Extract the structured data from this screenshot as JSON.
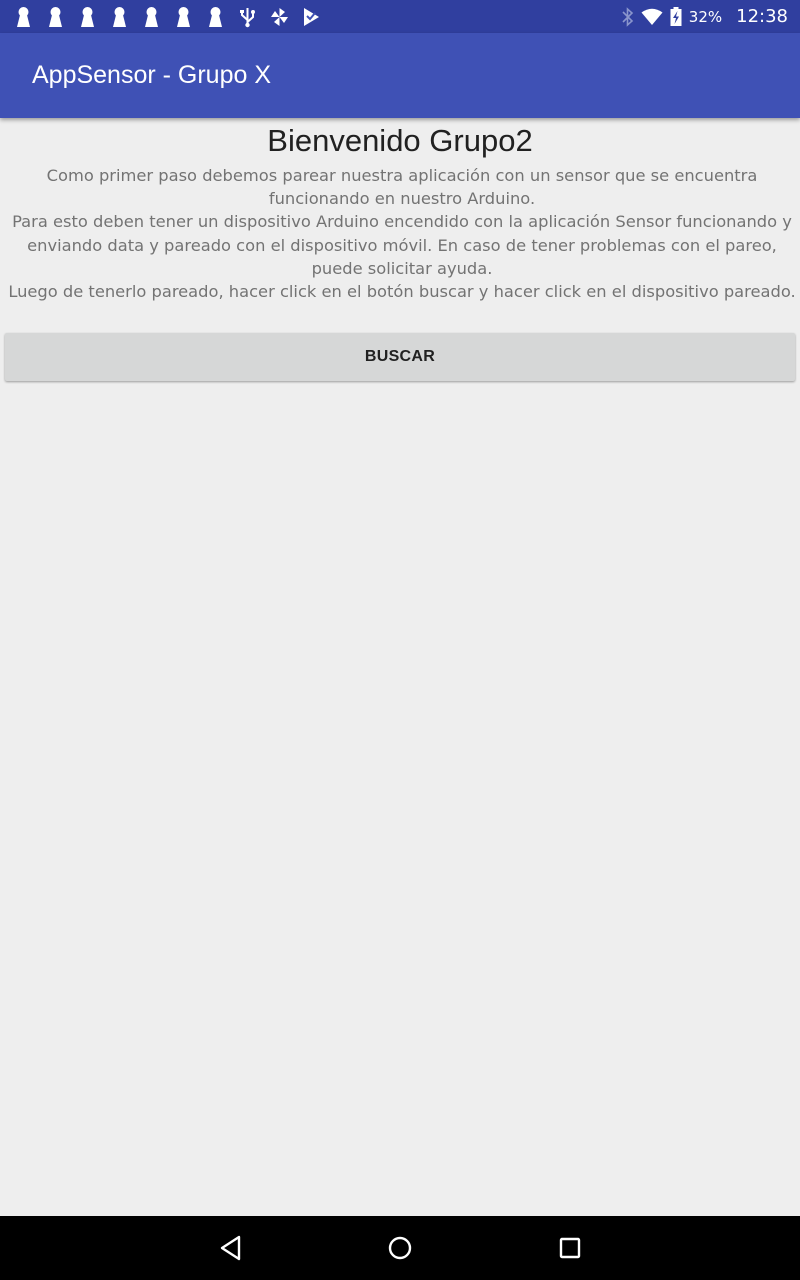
{
  "status_bar": {
    "notification_icons": [
      "keyhole-icon",
      "keyhole-icon",
      "keyhole-icon",
      "keyhole-icon",
      "keyhole-icon",
      "keyhole-icon",
      "keyhole-icon",
      "usb-icon",
      "pinwheel-icon",
      "check-flag-icon"
    ],
    "bluetooth_icon": "bluetooth-icon",
    "wifi_icon": "wifi-icon",
    "battery_icon": "battery-charging-icon",
    "battery_percent": "32%",
    "time": "12:38"
  },
  "app_bar": {
    "title": "AppSensor - Grupo X",
    "color": "#3f51b5",
    "status_color": "#303f9f"
  },
  "main": {
    "welcome": "Bienvenido Grupo2",
    "instructions": [
      "Como primer paso debemos parear nuestra aplicación con un sensor que se encuentra funcionando en nuestro Arduino.",
      "Para esto deben tener un dispositivo Arduino encendido con la aplicación Sensor funcionando y enviando data y pareado con el dispositivo móvil. En caso de tener problemas con el pareo, puede solicitar ayuda.",
      "Luego de tenerlo pareado, hacer click en el botón buscar y hacer click en el dispositivo pareado."
    ],
    "search_button": "BUSCAR"
  },
  "nav_bar": {
    "back": "back-icon",
    "home": "home-icon",
    "recents": "recents-icon"
  }
}
